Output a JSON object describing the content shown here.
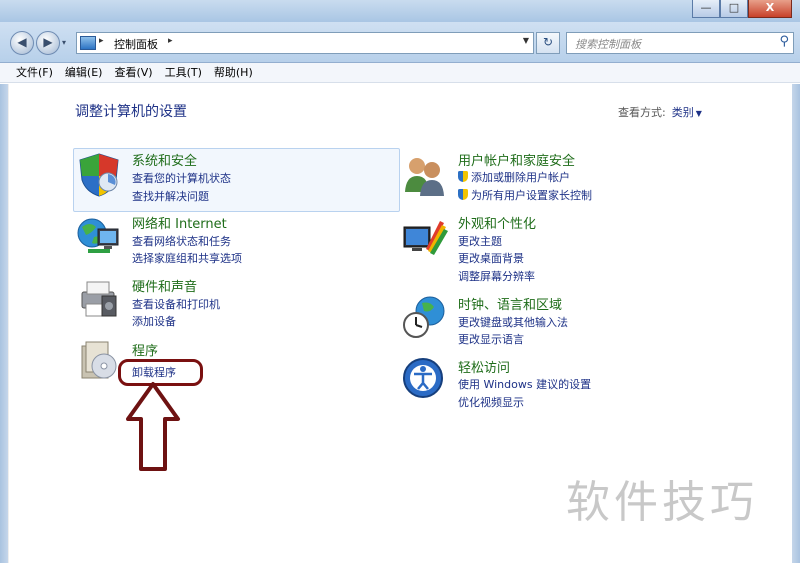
{
  "window": {
    "minimize": "—",
    "maximize": "□",
    "close": "X"
  },
  "nav": {
    "back": "◀",
    "forward": "▶",
    "recent": "▾",
    "refresh": "↻"
  },
  "address": {
    "path": [
      "控制面板"
    ],
    "sep": "▸"
  },
  "search": {
    "placeholder": "搜索控制面板",
    "icon": "search-icon"
  },
  "menu": [
    "文件(F)",
    "编辑(E)",
    "查看(V)",
    "工具(T)",
    "帮助(H)"
  ],
  "page": {
    "title": "调整计算机的设置",
    "view_by_label": "查看方式:",
    "view_by_value": "类别",
    "view_by_arrow": "▼"
  },
  "categories": [
    {
      "title": "系统和安全",
      "icon": "security-shield-icon",
      "links": [
        "查看您的计算机状态",
        "查找并解决问题"
      ]
    },
    {
      "title": "网络和 Internet",
      "icon": "network-globe-icon",
      "links": [
        "查看网络状态和任务",
        "选择家庭组和共享选项"
      ]
    },
    {
      "title": "硬件和声音",
      "icon": "printer-icon",
      "links": [
        "查看设备和打印机",
        "添加设备"
      ]
    },
    {
      "title": "程序",
      "icon": "programs-disc-icon",
      "links": [
        "卸载程序"
      ]
    },
    {
      "title": "用户帐户和家庭安全",
      "icon": "users-icon",
      "links": [
        "添加或删除用户帐户",
        "为所有用户设置家长控制"
      ]
    },
    {
      "title": "外观和个性化",
      "icon": "display-palette-icon",
      "links": [
        "更改主题",
        "更改桌面背景",
        "调整屏幕分辨率"
      ]
    },
    {
      "title": "时钟、语言和区域",
      "icon": "clock-globe-icon",
      "links": [
        "更改键盘或其他输入法",
        "更改显示语言"
      ]
    },
    {
      "title": "轻松访问",
      "icon": "ease-of-access-icon",
      "links": [
        "使用 Windows 建议的设置",
        "优化视频显示"
      ]
    }
  ],
  "watermark": "软件技巧",
  "colors": {
    "category_title": "#1f6d1a",
    "link": "#1e3287",
    "annotation": "#7a1010"
  }
}
